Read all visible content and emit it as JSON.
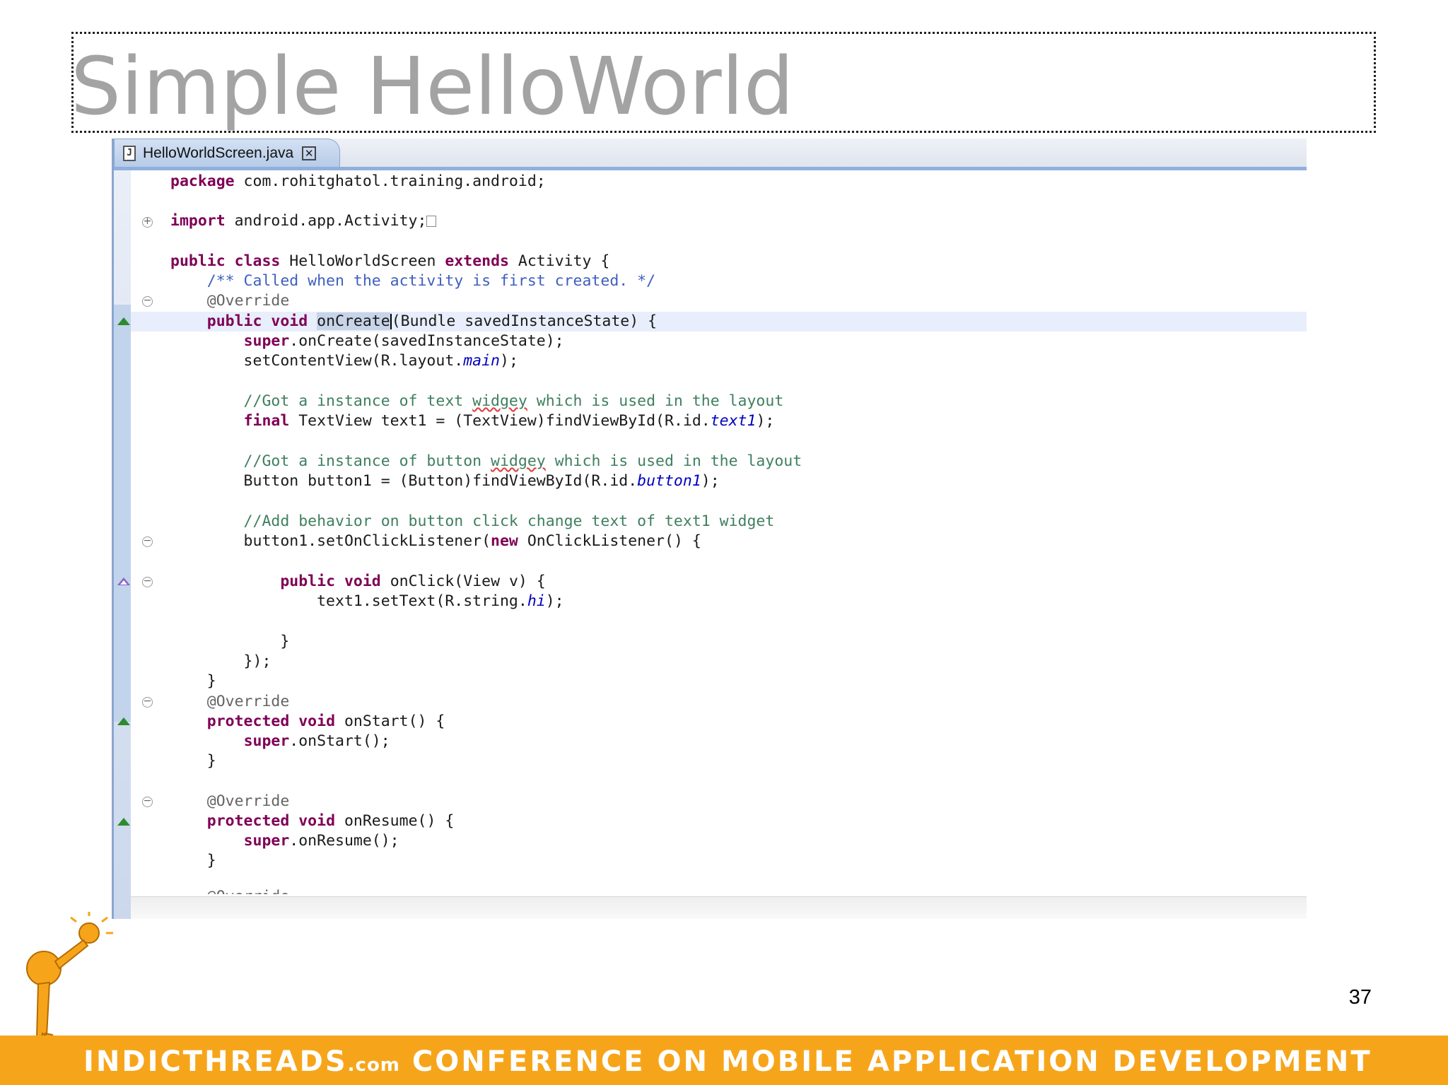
{
  "slide": {
    "title": "Simple HelloWorld",
    "page_number": "37",
    "footer": {
      "brand": "INDICTHREADS",
      "brand_suffix": ".com",
      "tagline": "CONFERENCE ON MOBILE APPLICATION DEVELOPMENT",
      "bar_color": "#f6a51b"
    }
  },
  "editor": {
    "tab": {
      "icon": "java-file-icon",
      "icon_glyph": "J",
      "filename": "HelloWorldScreen.java",
      "close_glyph": "✕"
    },
    "code": {
      "l1_kw": "package",
      "l1_rest": " com.rohitghatol.training.android;",
      "l2_kw": "import",
      "l2_rest": " android.app.Activity;",
      "l3_kw1": "public",
      "l3_kw2": "class",
      "l3_name": " HelloWorldScreen ",
      "l3_kw3": "extends",
      "l3_rest": " Activity {",
      "l4_javadoc": "    /** Called when the activity is first created. */",
      "l5_annotation": "    @Override",
      "l6_indent": "    ",
      "l6_kw1": "public",
      "l6_kw2": "void",
      "l6_method": "onCreate",
      "l6_rest": "(Bundle savedInstanceState) {",
      "l7_indent": "        ",
      "l7_kw": "super",
      "l7_rest": ".onCreate(savedInstanceState);",
      "l8_pre": "        setContentView(R.layout.",
      "l8_field": "main",
      "l8_post": ");",
      "l9_pre": "        //Got a instance of text ",
      "l9_typo": "widgey",
      "l9_post": " which is used in the layout",
      "l10_indent": "        ",
      "l10_kw": "final",
      "l10_pre": " TextView text1 = (TextView)findViewById(R.id.",
      "l10_field": "text1",
      "l10_post": ");",
      "l11_pre": "        //Got a instance of button ",
      "l11_typo": "widgey",
      "l11_post": " which is used in the layout",
      "l12_pre": "        Button button1 = (Button)findViewById(R.id.",
      "l12_field": "button1",
      "l12_post": ");",
      "l13_comment": "        //Add behavior on button click change text of text1 widget",
      "l14_pre": "        button1.setOnClickListener(",
      "l14_kw": "new",
      "l14_post": " OnClickListener() {",
      "l15_indent": "            ",
      "l15_kw1": "public",
      "l15_kw2": "void",
      "l15_rest": " onClick(View v) {",
      "l16_pre": "                text1.setText(R.string.",
      "l16_field": "hi",
      "l16_post": ");",
      "l17": "            }",
      "l18": "        });",
      "l19": "    }",
      "l20_annotation": "    @Override",
      "l21_indent": "    ",
      "l21_kw1": "protected",
      "l21_kw2": "void",
      "l21_rest": " onStart() {",
      "l22_indent": "        ",
      "l22_kw": "super",
      "l22_rest": ".onStart();",
      "l23": "    }",
      "l24_annotation": "    @Override",
      "l25_indent": "    ",
      "l25_kw1": "protected",
      "l25_kw2": "void",
      "l25_rest": " onResume() {",
      "l26_indent": "        ",
      "l26_kw": "super",
      "l26_rest": ".onResume();",
      "l27": "    }",
      "l28_annotation": "    @Override"
    }
  },
  "colors": {
    "keyword": "#7f0055",
    "comment": "#3f7f5f",
    "javadoc": "#3f5fbf",
    "field": "#0000c0",
    "title_gray": "#a3a3a3"
  }
}
